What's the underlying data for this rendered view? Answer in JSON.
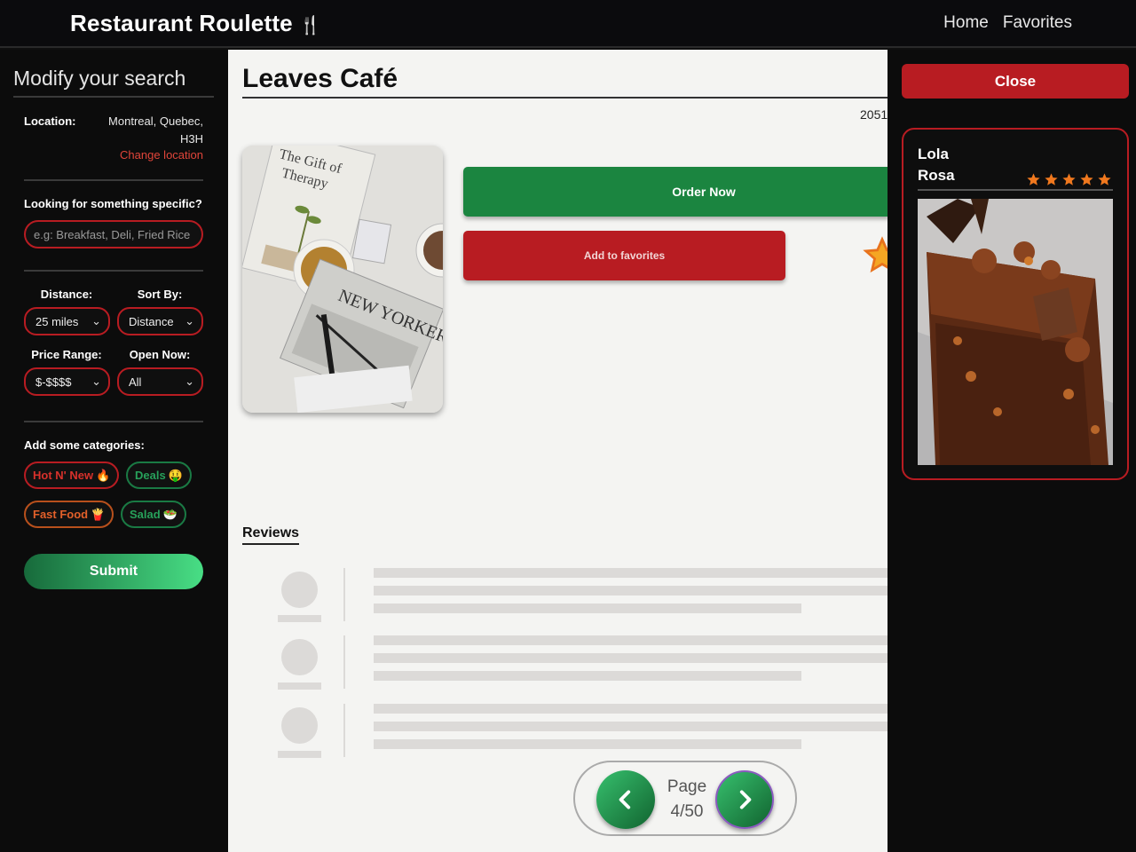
{
  "header": {
    "brand": "Restaurant Roulette",
    "brand_icon": "fork-knife-icon",
    "nav": {
      "home": "Home",
      "favorites": "Favorites"
    }
  },
  "sidebar": {
    "title": "Modify your search",
    "location": {
      "label": "Location:",
      "value": "Montreal, Quebec, H3H",
      "change": "Change location"
    },
    "specific": {
      "label": "Looking for something specific?",
      "placeholder": "e.g: Breakfast, Deli, Fried Rice"
    },
    "distance": {
      "label": "Distance:",
      "value": "25 miles"
    },
    "sort": {
      "label": "Sort By:",
      "value": "Distance"
    },
    "price": {
      "label": "Price Range:",
      "value": "$-$$$$"
    },
    "open": {
      "label": "Open Now:",
      "value": "All"
    },
    "categories": {
      "label": "Add some categories:",
      "items": [
        {
          "label": "Hot N' New",
          "emoji": "🔥"
        },
        {
          "label": "Deals",
          "emoji": "🤑"
        },
        {
          "label": "Fast Food",
          "emoji": "🍟"
        },
        {
          "label": "Salad",
          "emoji": "🥗"
        }
      ]
    },
    "submit": "Submit"
  },
  "main": {
    "title": "Leaves Café",
    "address_partial": "2051",
    "order_now": "Order Now",
    "add_favorites": "Add to favorites",
    "reviews_label": "Reviews",
    "pager": {
      "label": "Page",
      "current": 4,
      "total": 50,
      "text": "4/50"
    }
  },
  "panel": {
    "close": "Close",
    "card": {
      "name": "Lola Rosa",
      "rating": 5,
      "rating_max": 5
    }
  },
  "colors": {
    "accent_red": "#b81c22",
    "accent_green": "#1b8540",
    "star": "#f0781e"
  }
}
